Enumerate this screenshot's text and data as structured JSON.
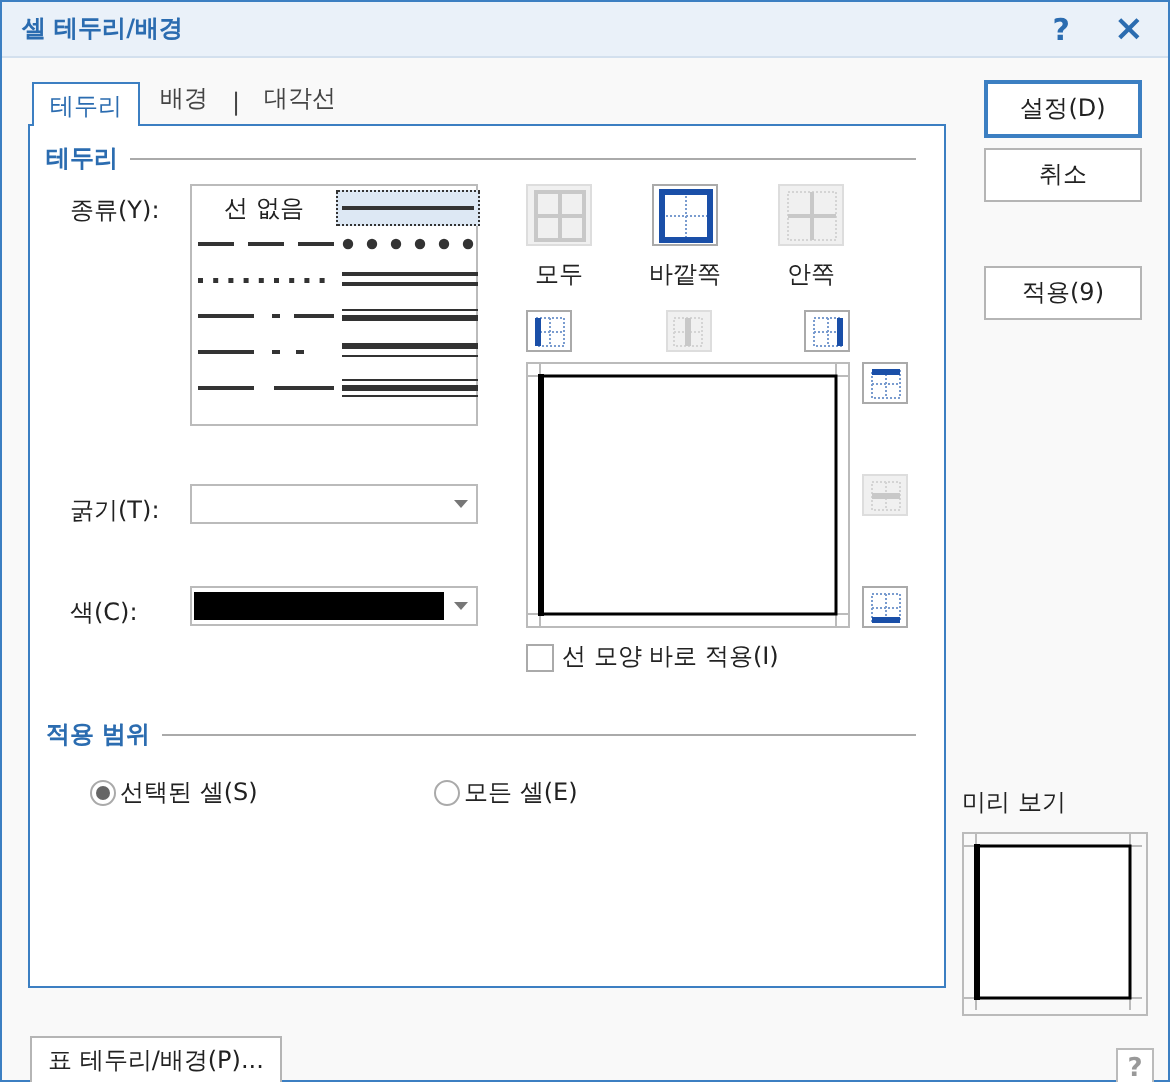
{
  "window": {
    "title": "셀 테두리/배경",
    "help_button": "?",
    "close_button": "×"
  },
  "tabs": [
    {
      "kind": "tab",
      "label": "테두리",
      "selected": true
    },
    {
      "kind": "tab",
      "label": "배경",
      "selected": false
    },
    {
      "kind": "separator",
      "label": "|"
    },
    {
      "kind": "tab",
      "label": "대각선",
      "selected": false
    }
  ],
  "border_section": {
    "title": "테두리",
    "type_label": "종류(Y):",
    "line_styles": [
      {
        "kind": "none",
        "label": "선 없음",
        "selected": false
      },
      {
        "kind": "solid",
        "selected": true
      },
      {
        "kind": "dash",
        "selected": false
      },
      {
        "kind": "round-dots",
        "selected": false
      },
      {
        "kind": "dotted",
        "selected": false
      },
      {
        "kind": "double",
        "selected": false
      },
      {
        "kind": "dash-dot",
        "selected": false
      },
      {
        "kind": "thick-thin",
        "selected": false
      },
      {
        "kind": "dash-dot-dot",
        "selected": false
      },
      {
        "kind": "thin-thick",
        "selected": false
      },
      {
        "kind": "long-dash",
        "selected": false
      },
      {
        "kind": "triple",
        "selected": false
      }
    ],
    "width_label": "굵기(T):",
    "color_label": "색(C):",
    "color": "#000000",
    "presets": [
      {
        "kind": "all",
        "label": "모두",
        "disabled": true
      },
      {
        "kind": "outside",
        "label": "바깥쪽",
        "disabled": false
      },
      {
        "kind": "inside",
        "label": "안쪽",
        "disabled": true
      }
    ],
    "top_toggles": [
      {
        "kind": "left",
        "disabled": false
      },
      {
        "kind": "vertical",
        "disabled": true
      },
      {
        "kind": "right",
        "disabled": false
      }
    ],
    "side_toggles": [
      {
        "kind": "top",
        "disabled": false
      },
      {
        "kind": "horizontal",
        "disabled": true
      },
      {
        "kind": "bottom",
        "disabled": false
      }
    ],
    "apply_now": {
      "label": "선 모양 바로 적용(I)",
      "checked": false
    }
  },
  "scope_section": {
    "title": "적용 범위",
    "options": [
      {
        "label": "선택된 셀(S)",
        "selected": true
      },
      {
        "label": "모든 셀(E)",
        "selected": false
      }
    ]
  },
  "buttons": [
    {
      "label": "설정(D)",
      "default": true
    },
    {
      "label": "취소",
      "default": false
    },
    {
      "label": "적용(9)",
      "default": false
    }
  ],
  "preview_label": "미리 보기",
  "table_button": "표 테두리/배경(P)...",
  "help_icon": "?"
}
